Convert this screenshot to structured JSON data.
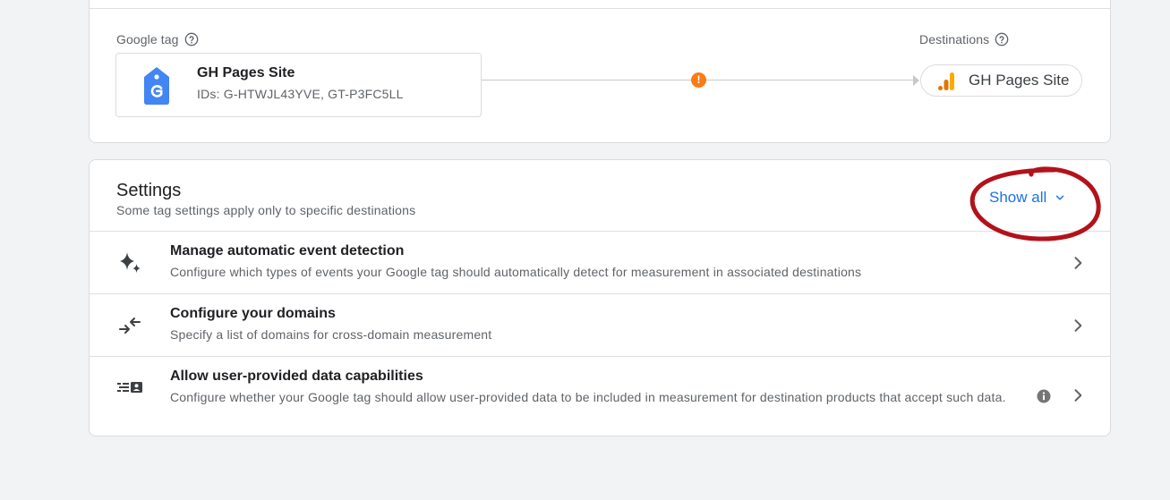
{
  "google_tag": {
    "section_label": "Google tag",
    "name": "GH Pages Site",
    "ids": "IDs: G-HTWJL43YVE, GT-P3FC5LL"
  },
  "destinations": {
    "section_label": "Destinations",
    "chip_label": "GH Pages Site"
  },
  "connector": {
    "warning_symbol": "!"
  },
  "settings": {
    "title": "Settings",
    "subtitle": "Some tag settings apply only to specific destinations",
    "show_all_label": "Show all",
    "rows": [
      {
        "title": "Manage automatic event detection",
        "description": "Configure which types of events your Google tag should automatically detect for measurement in associated destinations",
        "icon": "sparkle-icon"
      },
      {
        "title": "Configure your domains",
        "description": "Specify a list of domains for cross-domain measurement",
        "icon": "merge-arrows-icon"
      },
      {
        "title": "Allow user-provided data capabilities",
        "description": "Configure whether your Google tag should allow user-provided data to be included in measurement for destination products that accept such data.",
        "icon": "user-data-icon"
      }
    ]
  },
  "colors": {
    "accent": "#1a73e8",
    "warning": "#fa7b17",
    "annotation": "#b3121b",
    "tag_logo": "#4285f4",
    "analytics_orange": "#f9ab00",
    "analytics_dark_orange": "#e37400"
  }
}
